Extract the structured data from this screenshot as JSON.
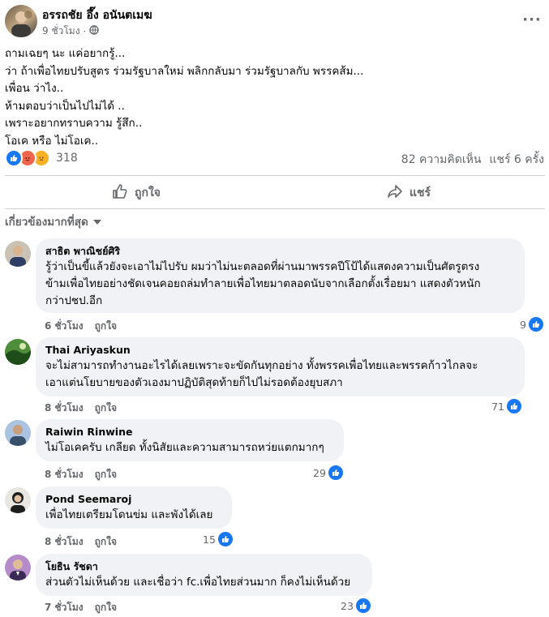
{
  "post": {
    "author": "อรรถชัย อึ๊ง อนันตเมฆ",
    "time": "9 ชั่วโมง",
    "audience_icon": "globe-icon",
    "lines": [
      "ถามเฉยๆ นะ แค่อยากรู้...",
      "ว่า ถ้าเพื่อไทยปรับสูตร ร่วมรัฐบาลใหม่  พลิกกลับมา ร่วมรัฐบาลกับ พรรคส้ม...",
      "เพื่อน ว่าไง..",
      "ห้ามตอบว่าเป็นไปไม่ได้ ..",
      "เพราะอยากทราบความ รู้สึก..",
      "โอเค หรือ ไม่โอเค.."
    ],
    "reaction_count": "318",
    "reaction_icons": [
      "like-icon",
      "angry-icon",
      "sad-icon"
    ],
    "comments_count": "82 ความคิดเห็น",
    "shares_count": "แชร์ 6 ครั้ง"
  },
  "actions": {
    "like_label": "ถูกใจ",
    "share_label": "แชร์"
  },
  "sort_label": "เกี่ยวข้องมากที่สุด",
  "comments": [
    {
      "name": "สาธิต พาณิชย์ศิริ",
      "lines": [
        "รู้ว่าเป็นขี้แล้วยังจะเอาไม่ไปรับ ผมว่าไม่นะตลอดที่ผ่านมาพรรคปีโป้ได้แสดงความเป็นศัตรูตรง",
        "ข้ามเพื่อไทยอย่างชัดเจนคอยถล่มทำลายเพื่อไทยมาตลอดนับจากเลือกตั้งเรื่อยมา แสดงตัวหนัก",
        "กว่าปชป.อีก"
      ],
      "time": "6 ชั่วโมง",
      "like_label": "ถูกใจ",
      "likes": "9",
      "colors": [
        "#c9c2b5",
        "#2f3f63"
      ]
    },
    {
      "name": "Thai Ariyaskun",
      "lines": [
        "จะไม่สามารถทำงานอะไรได้เลยเพราะจะขัดกันทุกอย่าง ทั้งพรรคเพื่อไทยและพรรคก้าวไกลจะ",
        "เอาแต่นโยบายของตัวเองมาปฏิบัติสุดท้ายก็ไปไม่รอดต้องยุบสภา"
      ],
      "time": "8 ชั่วโมง",
      "like_label": "ถูกใจ",
      "likes": "71",
      "colors": [
        "#4e8d3a",
        "#1f4d1a"
      ]
    },
    {
      "name": "Raiwin Rinwine",
      "lines": [
        "ไม่โอเคครับ เกลียด ทั้งนิสัยและความสามารถหว่ยแตกมากๆ"
      ],
      "time": "8 ชั่วโมง",
      "like_label": "ถูกใจ",
      "likes": "29",
      "colors": [
        "#a9c3e0",
        "#39506b"
      ]
    },
    {
      "name": "Pond Seemaroj",
      "lines": [
        "เพื่อไทยเตรียมโดนข่ม และพังได้เลย"
      ],
      "time": "8 ชั่วโมง",
      "like_label": "ถูกใจ",
      "likes": "15",
      "colors": [
        "#e9e6e2",
        "#1d1d1d"
      ]
    },
    {
      "name": "โยธิน รัชดา",
      "lines": [
        "ส่วนตัวไม่เห็นด้วย และเชื่อว่า fc.เพื่อไทยส่วนมาก ก็คงไม่เห็นด้วย"
      ],
      "time": "7 ชั่วโมง",
      "like_label": "ถูกใจ",
      "likes": "23",
      "colors": [
        "#b58bc9",
        "#3a2a55"
      ]
    }
  ],
  "colors": {
    "accent": "#1877f2",
    "secondary_text": "#65676b",
    "bubble_bg": "#f0f2f5"
  }
}
